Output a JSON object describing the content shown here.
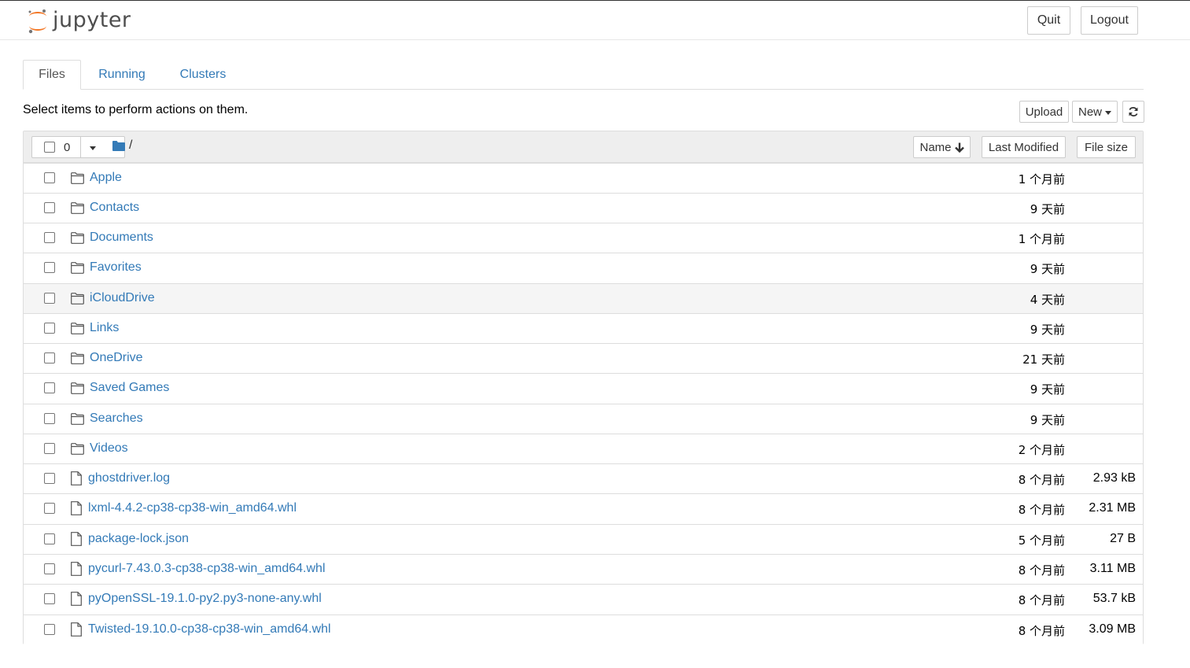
{
  "header": {
    "logo_text": "jupyter",
    "quit_label": "Quit",
    "logout_label": "Logout"
  },
  "tabs": [
    {
      "label": "Files",
      "active": true
    },
    {
      "label": "Running",
      "active": false
    },
    {
      "label": "Clusters",
      "active": false
    }
  ],
  "toolbar": {
    "message": "Select items to perform actions on them.",
    "upload_label": "Upload",
    "new_label": "New"
  },
  "list_header": {
    "selected_count": "0",
    "breadcrumb": "/",
    "sort_name": "Name",
    "sort_modified": "Last Modified",
    "sort_size": "File size"
  },
  "items": [
    {
      "type": "folder",
      "name": "Apple",
      "modified": "1 个月前",
      "size": ""
    },
    {
      "type": "folder",
      "name": "Contacts",
      "modified": "9 天前",
      "size": ""
    },
    {
      "type": "folder",
      "name": "Documents",
      "modified": "1 个月前",
      "size": ""
    },
    {
      "type": "folder",
      "name": "Favorites",
      "modified": "9 天前",
      "size": ""
    },
    {
      "type": "folder",
      "name": "iCloudDrive",
      "modified": "4 天前",
      "size": ""
    },
    {
      "type": "folder",
      "name": "Links",
      "modified": "9 天前",
      "size": ""
    },
    {
      "type": "folder",
      "name": "OneDrive",
      "modified": "21 天前",
      "size": ""
    },
    {
      "type": "folder",
      "name": "Saved Games",
      "modified": "9 天前",
      "size": ""
    },
    {
      "type": "folder",
      "name": "Searches",
      "modified": "9 天前",
      "size": ""
    },
    {
      "type": "folder",
      "name": "Videos",
      "modified": "2 个月前",
      "size": ""
    },
    {
      "type": "file",
      "name": "ghostdriver.log",
      "modified": "8 个月前",
      "size": "2.93 kB"
    },
    {
      "type": "file",
      "name": "lxml-4.4.2-cp38-cp38-win_amd64.whl",
      "modified": "8 个月前",
      "size": "2.31 MB"
    },
    {
      "type": "file",
      "name": "package-lock.json",
      "modified": "5 个月前",
      "size": "27 B"
    },
    {
      "type": "file",
      "name": "pycurl-7.43.0.3-cp38-cp38-win_amd64.whl",
      "modified": "8 个月前",
      "size": "3.11 MB"
    },
    {
      "type": "file",
      "name": "pyOpenSSL-19.1.0-py2.py3-none-any.whl",
      "modified": "8 个月前",
      "size": "53.7 kB"
    },
    {
      "type": "file",
      "name": "Twisted-19.10.0-cp38-cp38-win_amd64.whl",
      "modified": "8 个月前",
      "size": "3.09 MB"
    }
  ],
  "colors": {
    "link": "#337ab7",
    "logo_orange": "#f37726",
    "header_bg": "#eeeeee",
    "border": "#dddddd"
  }
}
